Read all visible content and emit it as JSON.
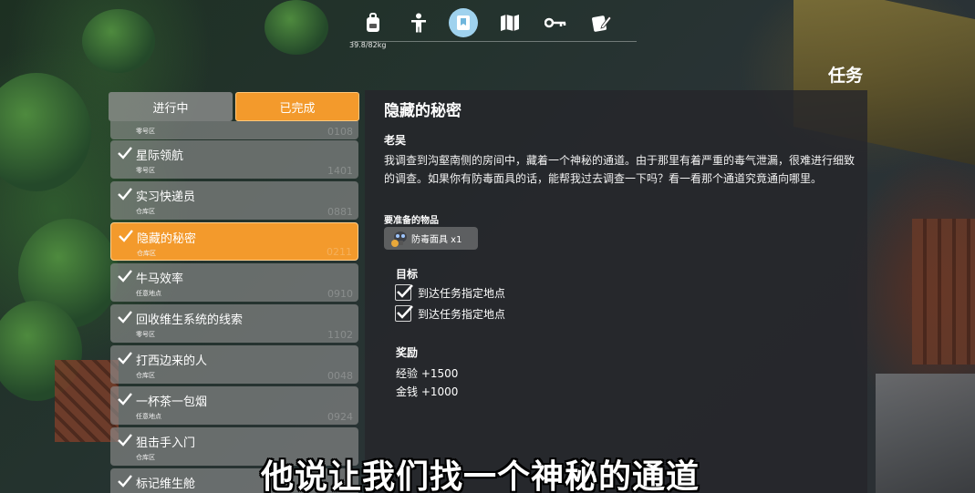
{
  "hud": {
    "weight": "39.8/82kg",
    "page_title": "任务",
    "nav_icons": [
      "backpack-icon",
      "character-icon",
      "quest-icon",
      "map-icon",
      "key-icon",
      "notes-icon"
    ],
    "active_nav": "quest-icon",
    "accent_color": "#f39a2c"
  },
  "tabs": {
    "in_progress": "进行中",
    "completed": "已完成",
    "active": "completed"
  },
  "quests": [
    {
      "name": "",
      "location": "零号区",
      "number": "0108",
      "selected": false
    },
    {
      "name": "星际领航",
      "location": "零号区",
      "number": "1401",
      "selected": false
    },
    {
      "name": "实习快递员",
      "location": "仓库区",
      "number": "0881",
      "selected": false
    },
    {
      "name": "隐藏的秘密",
      "location": "仓库区",
      "number": "0211",
      "selected": true
    },
    {
      "name": "牛马效率",
      "location": "任意地点",
      "number": "0910",
      "selected": false
    },
    {
      "name": "回收维生系统的线索",
      "location": "零号区",
      "number": "1102",
      "selected": false
    },
    {
      "name": "打西边来的人",
      "location": "仓库区",
      "number": "0048",
      "selected": false
    },
    {
      "name": "一杯茶一包烟",
      "location": "任意地点",
      "number": "0924",
      "selected": false
    },
    {
      "name": "狙击手入门",
      "location": "仓库区",
      "number": "",
      "selected": false
    },
    {
      "name": "标记维生舱",
      "location": "",
      "number": "",
      "selected": false
    }
  ],
  "detail": {
    "title": "隐藏的秘密",
    "giver": "老吴",
    "description": "我调查到沟壑南侧的房间中，藏着一个神秘的通道。由于那里有着严重的毒气泄漏，很难进行细致的调查。如果你有防毒面具的话，能帮我过去调查一下吗？看一看那个通道究竟通向哪里。",
    "required_label": "要准备的物品",
    "required_item": "防毒面具 x1",
    "goal_label": "目标",
    "goals": [
      "到达任务指定地点",
      "到达任务指定地点"
    ],
    "reward_label": "奖励",
    "rewards": [
      "经验 +1500",
      "金钱 +1000"
    ]
  },
  "subtitle": "他说让我们找一个神秘的通道"
}
